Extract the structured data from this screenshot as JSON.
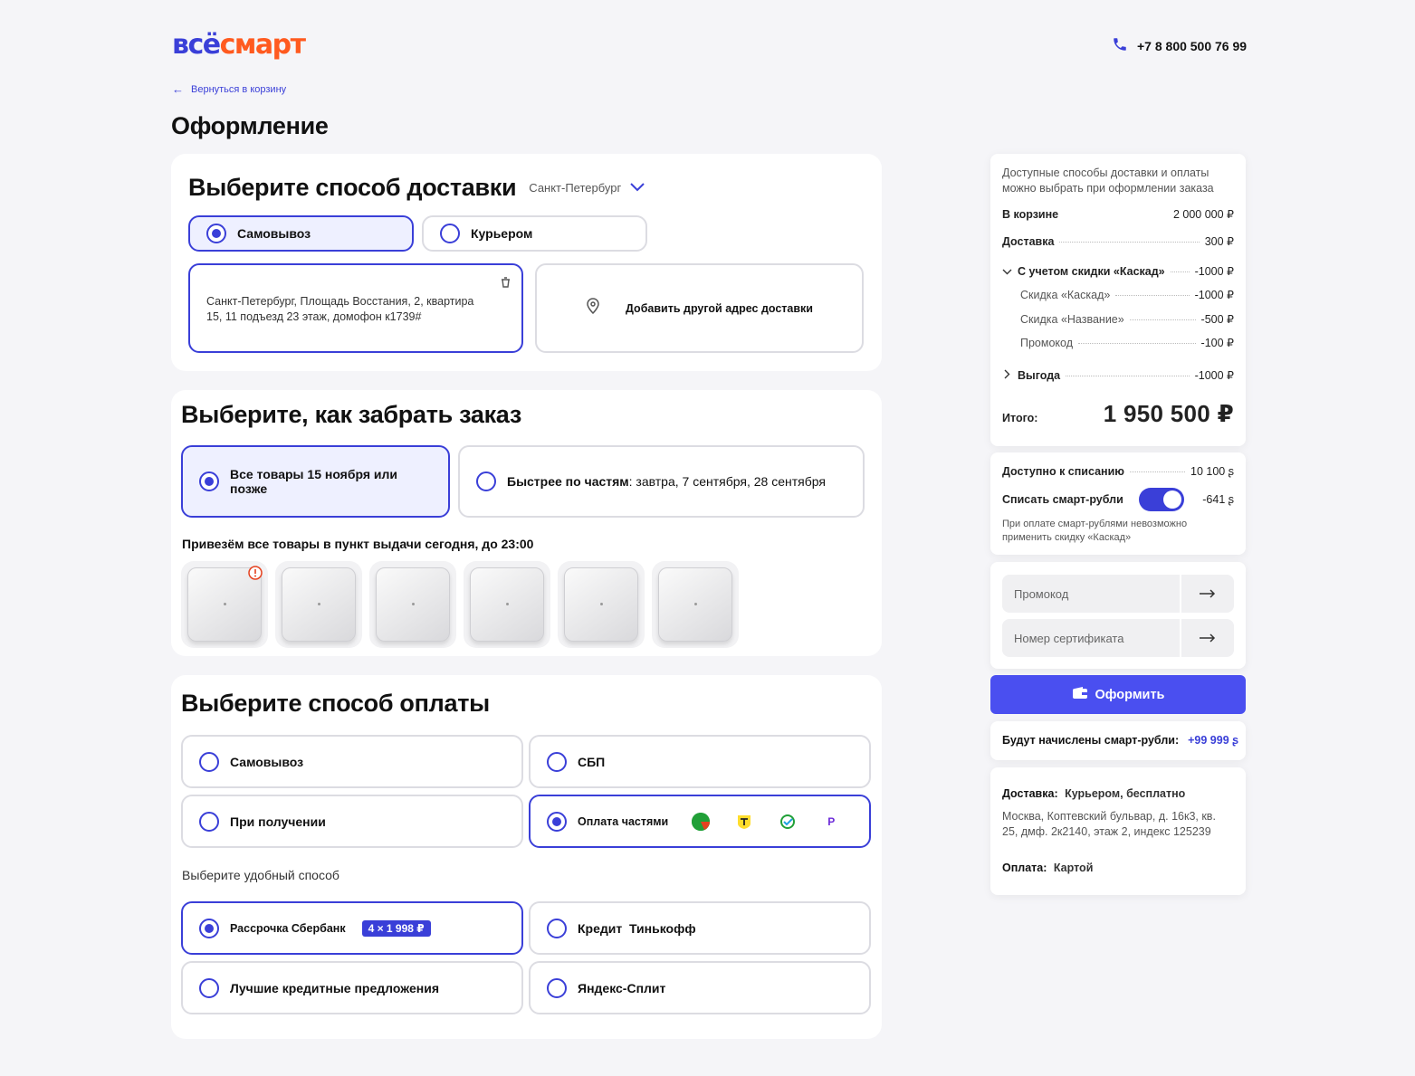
{
  "header": {
    "logo_part1": "всё",
    "logo_part2": "смарт",
    "phone": "+7 8 800 500 76 99",
    "back_link": "Вернуться в корзину",
    "page_title": "Оформление"
  },
  "delivery": {
    "title": "Выберите способ доставки",
    "city": "Санкт-Петербург",
    "options": [
      "Самовывоз",
      "Курьером"
    ],
    "selected_index": 0,
    "address_line1": "Санкт-Петербург, Площадь Восстания, 2, квартира",
    "address_line2": "15, 11 подъезд 23 этаж, домофон к1739#",
    "add_address": "Добавить другой адрес доставки"
  },
  "pickup": {
    "title": "Выберите, как забрать заказ",
    "option_all": "Все товары 15 ноября или позже",
    "option_parts_bold": "Быстрее по частям",
    "option_parts_rest": ": завтра, 7 сентября, 28 сентября",
    "notice": "Привезём все товары в пункт выдачи сегодня, до 23:00",
    "product_count": 6
  },
  "payment": {
    "title": "Выберите способ оплаты",
    "options": [
      "Самовывоз",
      "СБП",
      "При получении",
      "Оплата частями"
    ],
    "selected_index": 3,
    "subtitle": "Выберите удобный способ",
    "methods": [
      "Рассрочка Сбербанк",
      "Кредит  Тинькофф",
      "Лучшие кредитные предложения",
      "Яндекс-Сплит"
    ],
    "methods_selected_index": 0,
    "installment_badge": "4 × 1 998 ₽",
    "provider_icons": [
      "sber-icon",
      "tinkoff-icon",
      "sberpay-icon",
      "podeli-icon"
    ]
  },
  "summary": {
    "note": "Доступные способы доставки и оплаты можно выбрать при оформлении заказа",
    "in_cart_label": "В корзине",
    "in_cart_value": "2 000 000 ₽",
    "delivery_label": "Доставка",
    "delivery_value": "300 ₽",
    "discount_group_label": "С учетом скидки «Каскад»",
    "discount_group_value": "-1000 ₽",
    "discounts": [
      {
        "label": "Скидка «Каскад»",
        "value": "-1000 ₽"
      },
      {
        "label": "Скидка «Название»",
        "value": "-500 ₽"
      },
      {
        "label": "Промокод",
        "value": "-100 ₽"
      }
    ],
    "benefit_label": "Выгода",
    "benefit_value": "-1000 ₽",
    "total_label": "Итого:",
    "total_value": "1 950 500 ₽"
  },
  "smart_rubles": {
    "available_label": "Доступно к списанию",
    "available_value": "10 100 ʂ",
    "spend_label": "Списать смарт-рубли",
    "spend_value": "-641 ʂ",
    "toggle_on": true,
    "note": "При оплате смарт-рублями невозможно применить скидку «Каскад»"
  },
  "promo": {
    "promo_placeholder": "Промокод",
    "cert_placeholder": "Номер сертификата"
  },
  "checkout_button": "Оформить",
  "accrual": {
    "label": "Будут начислены смарт-рубли:",
    "value": "+99 999 ʂ"
  },
  "order_info": {
    "delivery_label": "Доставка:",
    "delivery_value": "Курьером, бесплатно",
    "address": "Москва, Коптевский бульвар, д. 16к3, кв. 25, дмф. 2к2140, этаж 2, индекс 125239",
    "payment_label": "Оплата:",
    "payment_value": "Картой"
  },
  "colors": {
    "accent": "#3a3fd8",
    "brand_orange": "#ff5a1f",
    "selected_bg": "#eef0ff",
    "warning": "#e5411e"
  }
}
